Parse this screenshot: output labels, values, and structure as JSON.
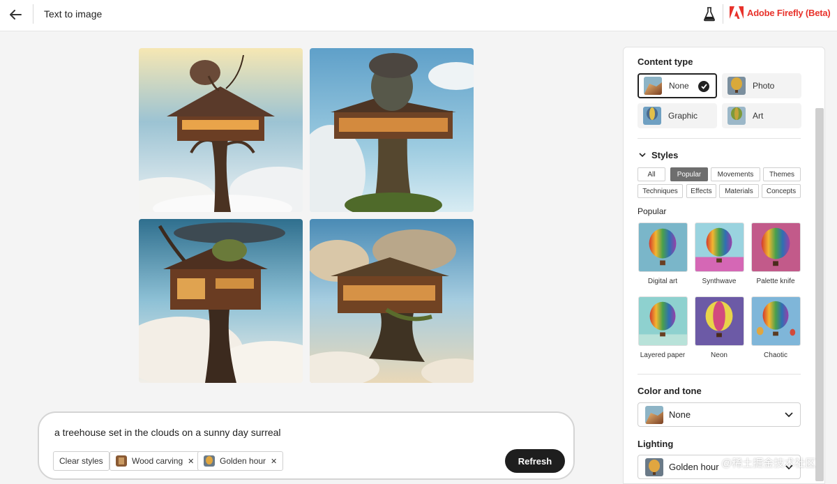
{
  "header": {
    "title": "Text to image",
    "brand": "Adobe Firefly (Beta)",
    "brand_color": "#e8322b"
  },
  "images": [
    {
      "name": "generated-image-1",
      "subject": "treehouse in clouds"
    },
    {
      "name": "generated-image-2",
      "subject": "treehouse in clouds"
    },
    {
      "name": "generated-image-3",
      "subject": "treehouse in clouds"
    },
    {
      "name": "generated-image-4",
      "subject": "treehouse in clouds"
    }
  ],
  "prompt": {
    "text": "a treehouse set in the clouds on a sunny day surreal",
    "clear_label": "Clear styles",
    "chips": [
      "Wood carving",
      "Golden hour"
    ],
    "refresh_label": "Refresh"
  },
  "panel": {
    "content_type": {
      "title": "Content type",
      "options": [
        "None",
        "Photo",
        "Graphic",
        "Art"
      ],
      "selected": "None"
    },
    "styles": {
      "title": "Styles",
      "tabs": [
        "All",
        "Popular",
        "Movements",
        "Themes",
        "Techniques",
        "Effects",
        "Materials",
        "Concepts"
      ],
      "active_tab": "Popular",
      "section": "Popular",
      "items": [
        "Digital art",
        "Synthwave",
        "Palette knife",
        "Layered paper",
        "Neon",
        "Chaotic"
      ]
    },
    "color_tone": {
      "title": "Color and tone",
      "value": "None"
    },
    "lighting": {
      "title": "Lighting",
      "value": "Golden hour"
    }
  },
  "watermark": "@稀土掘金技术社区"
}
